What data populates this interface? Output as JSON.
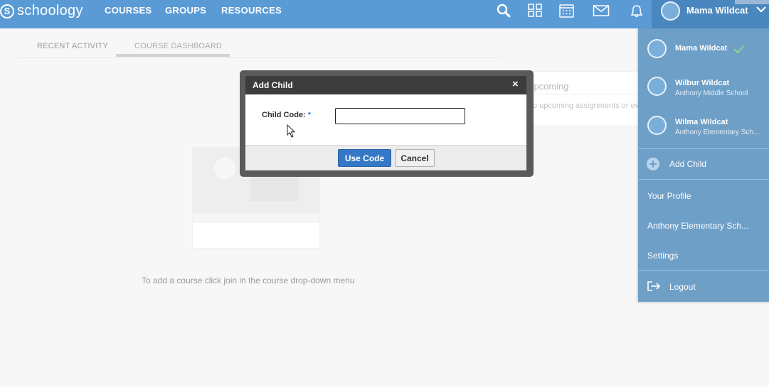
{
  "topbar": {
    "logo_mark": "S",
    "logo_text": "schoology",
    "nav": [
      "COURSES",
      "GROUPS",
      "RESOURCES"
    ],
    "icons": [
      "search-icon",
      "apps-grid-icon",
      "calendar-icon",
      "mail-icon",
      "notifications-icon"
    ],
    "user_name": "Mama Wildcat",
    "colors": {
      "bar": "#5b9bd5",
      "user_area": "#4a87bf"
    }
  },
  "tabs": {
    "recent_activity": "RECENT ACTIVITY",
    "course_dashboard": "COURSE DASHBOARD"
  },
  "upcoming": {
    "title": "Upcoming",
    "text": "No upcoming assignments or ev"
  },
  "empty_message": "To add a course click join in the course drop-down menu",
  "modal": {
    "title": "Add Child",
    "close": "×",
    "field_label": "Child Code:",
    "required_mark": "*",
    "input_value": "",
    "use_code": "Use Code",
    "cancel": "Cancel"
  },
  "dropdown": {
    "profiles": [
      {
        "name": "Mama Wildcat",
        "school": "",
        "active": true
      },
      {
        "name": "Wilbur Wildcat",
        "school": "Anthony Middle School"
      },
      {
        "name": "Wilma Wildcat",
        "school": "Anthony Elementary Sch..."
      }
    ],
    "add_child": "Add Child",
    "your_profile": "Your Profile",
    "school_link": "Anthony Elementary Sch...",
    "settings": "Settings",
    "logout": "Logout",
    "colors": {
      "background": "#6e9fc7",
      "check": "#8fd18f"
    }
  }
}
